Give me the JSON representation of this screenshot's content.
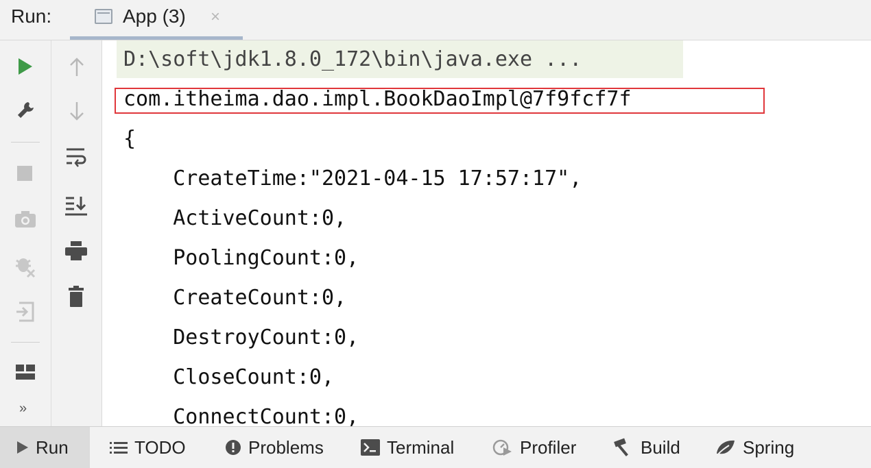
{
  "header": {
    "run_label": "Run:",
    "tab_label": "App (3)",
    "tab_close": "×"
  },
  "toolbar_left": {
    "icons": [
      "run-icon",
      "wrench-icon",
      "stop-icon",
      "camera-icon",
      "debug-off-icon",
      "login-icon",
      "layout-icon",
      "more-icon"
    ],
    "more": "»"
  },
  "toolbar_right": {
    "icons": [
      "arrow-up-icon",
      "arrow-down-icon",
      "soft-wrap-icon",
      "scroll-to-end-icon",
      "print-icon",
      "trash-icon"
    ]
  },
  "console": {
    "lines": [
      "D:\\soft\\jdk1.8.0_172\\bin\\java.exe ...",
      "com.itheima.dao.impl.BookDaoImpl@7f9fcf7f",
      "{",
      "    CreateTime:\"2021-04-15 17:57:17\",",
      "    ActiveCount:0,",
      "    PoolingCount:0,",
      "    CreateCount:0,",
      "    DestroyCount:0,",
      "    CloseCount:0,",
      "    ConnectCount:0,"
    ]
  },
  "bottom_bar": {
    "items": [
      "Run",
      "TODO",
      "Problems",
      "Terminal",
      "Profiler",
      "Build",
      "Spring"
    ]
  },
  "colors": {
    "run_green": "#3f9a48",
    "highlight_red": "#e0363b",
    "command_bg": "#eef3e6"
  }
}
